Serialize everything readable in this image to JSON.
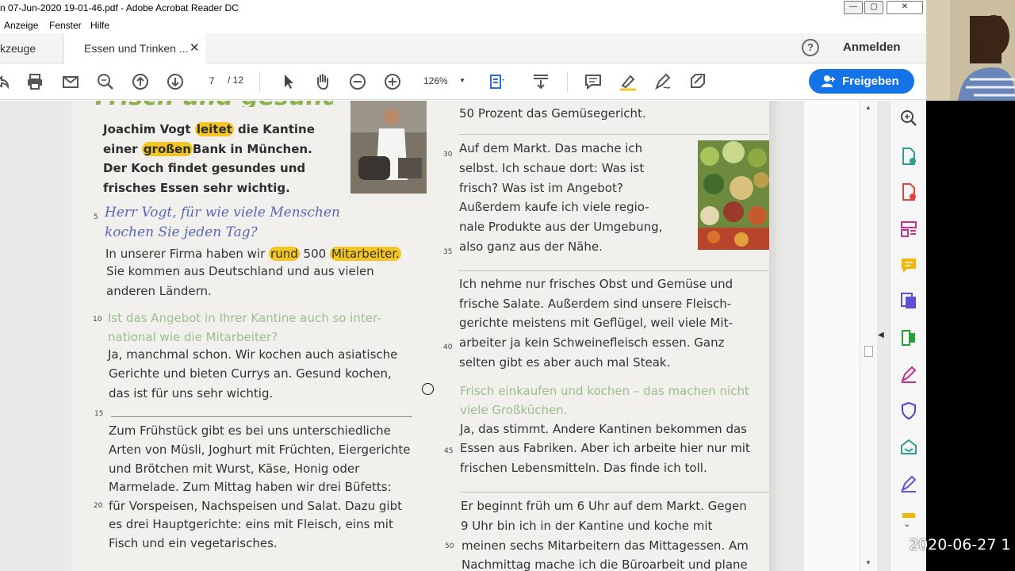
{
  "window": {
    "title": "n 07-Jun-2020   19-01-46.pdf - Adobe Acrobat Reader DC",
    "controls": {
      "minimize": "—",
      "maximize": "▢",
      "close": "✕"
    }
  },
  "menubar": {
    "items": [
      "Anzeige",
      "Fenster",
      "Hilfe"
    ]
  },
  "tabs": {
    "tools": "kzeuge",
    "document": "Essen und Trinken ...",
    "close": "✕"
  },
  "header": {
    "help": "?",
    "signin": "Anmelden"
  },
  "toolbar": {
    "page_current": "7",
    "page_total": "/ 12",
    "zoom": "126%",
    "zoom_caret": "▼",
    "share_label": "Freigeben"
  },
  "page": {
    "intro": [
      "Joachim Vogt",
      "leitet",
      "die Kantine",
      "einer",
      "großen",
      "Bank in München.",
      "Der Koch findet gesundes und",
      "frisches Essen sehr wichtig."
    ],
    "col1": {
      "question1": [
        "Herr Vogt, für wie viele Menschen",
        "kochen Sie jeden Tag?"
      ],
      "answer1_l1": [
        "In unserer Firma haben wir",
        "rund",
        "500",
        "Mitarbeiter."
      ],
      "answer1_rest": [
        "Sie kommen aus Deutschland und aus vielen",
        "anderen Ländern."
      ],
      "question2": [
        "Ist das Angebot in Ihrer Kantine auch so inter-",
        "national wie die Mitarbeiter?"
      ],
      "answer2": [
        "Ja, manchmal schon. Wir kochen auch asiatische",
        "Gerichte und bieten Currys an. Gesund kochen,",
        "das ist für uns sehr wichtig."
      ],
      "answer3": [
        "Zum Frühstück gibt es bei uns unterschiedliche",
        "Arten von Müsli, Joghurt mit Früchten, Eiergerichte",
        "und Brötchen mit Wurst, Käse, Honig oder",
        "Marmelade. Zum Mittag haben wir drei Büfetts:",
        "für Vorspeisen, Nachspeisen und Salat. Dazu gibt",
        "es drei Hauptgerichte: eins mit Fleisch, eins mit",
        "Fisch und ein vegetarisches."
      ],
      "line_numbers": [
        "5",
        "10",
        "15",
        "20"
      ]
    },
    "col2": {
      "top": "50 Prozent das Gemüsegericht.",
      "para1": [
        "Auf dem Markt. Das mache ich",
        "selbst. Ich schaue dort: Was ist",
        "frisch? Was ist im Angebot?",
        "Außerdem kaufe ich viele regio-",
        "nale Produkte aus der Umgebung,",
        "also ganz aus der Nähe."
      ],
      "para2": [
        "Ich nehme nur frisches Obst und Gemüse und",
        "frische Salate. Außerdem sind unsere Fleisch-",
        "gerichte meistens mit Geflügel, weil viele Mit-",
        "arbeiter ja kein Schweinefleisch essen. Ganz",
        "selten gibt es aber auch mal Steak."
      ],
      "question3": [
        "Frisch einkaufen und kochen – das machen nicht",
        "viele Großküchen."
      ],
      "para3": [
        "Ja, das stimmt. Andere Kantinen bekommen das",
        "Essen aus Fabriken. Aber ich arbeite hier nur mit",
        "frischen Lebensmitteln. Das finde ich toll."
      ],
      "para4": [
        "Er beginnt früh um 6 Uhr auf dem Markt. Gegen",
        "9 Uhr bin ich in der Kantine und koche mit",
        "meinen sechs Mitarbeitern das Mittagessen. Am",
        "Nachmittag mache ich die Büroarbeit und plane"
      ],
      "line_numbers": [
        "30",
        "35",
        "40",
        "45",
        "50"
      ]
    }
  },
  "overlay": {
    "timestamp": "2020-06-27  1"
  },
  "colors": {
    "accent": "#1473e6",
    "highlight": "#f3c623",
    "handwriting": "#5a67b8",
    "question_green": "#9bbf8e"
  }
}
